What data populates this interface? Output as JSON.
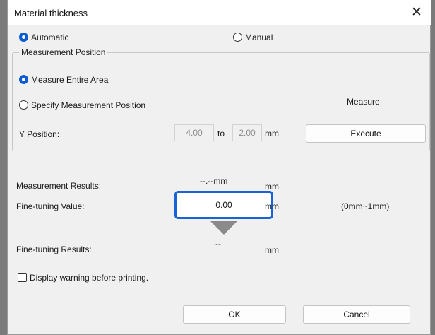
{
  "window": {
    "title": "Material thickness",
    "close_icon": "close-icon"
  },
  "mode": {
    "automatic_label": "Automatic",
    "manual_label": "Manual",
    "selected": "automatic"
  },
  "measurement_position": {
    "group_label": "Measurement Position",
    "entire_area_label": "Measure Entire Area",
    "specify_label": "Specify Measurement Position",
    "selected": "entire_area",
    "measure_label": "Measure",
    "y_position_label": "Y Position:",
    "y_from": "4.00",
    "to_label": "to",
    "y_to": "2.00",
    "unit": "mm",
    "execute_label": "Execute"
  },
  "results": {
    "measurement_label": "Measurement Results:",
    "measurement_value": "--.--mm",
    "measurement_unit": "mm",
    "fine_tuning_label": "Fine-tuning Value:",
    "fine_tuning_value": "0.00",
    "fine_tuning_unit": "mm",
    "fine_tuning_range": "(0mm~1mm)",
    "fine_results_label": "Fine-tuning Results:",
    "fine_results_value": "--",
    "fine_results_unit": "mm"
  },
  "warning": {
    "label": "Display warning before printing.",
    "checked": false
  },
  "buttons": {
    "ok_label": "OK",
    "cancel_label": "Cancel"
  },
  "colors": {
    "accent": "#0b5cd0",
    "focus_border": "#1764d8"
  }
}
